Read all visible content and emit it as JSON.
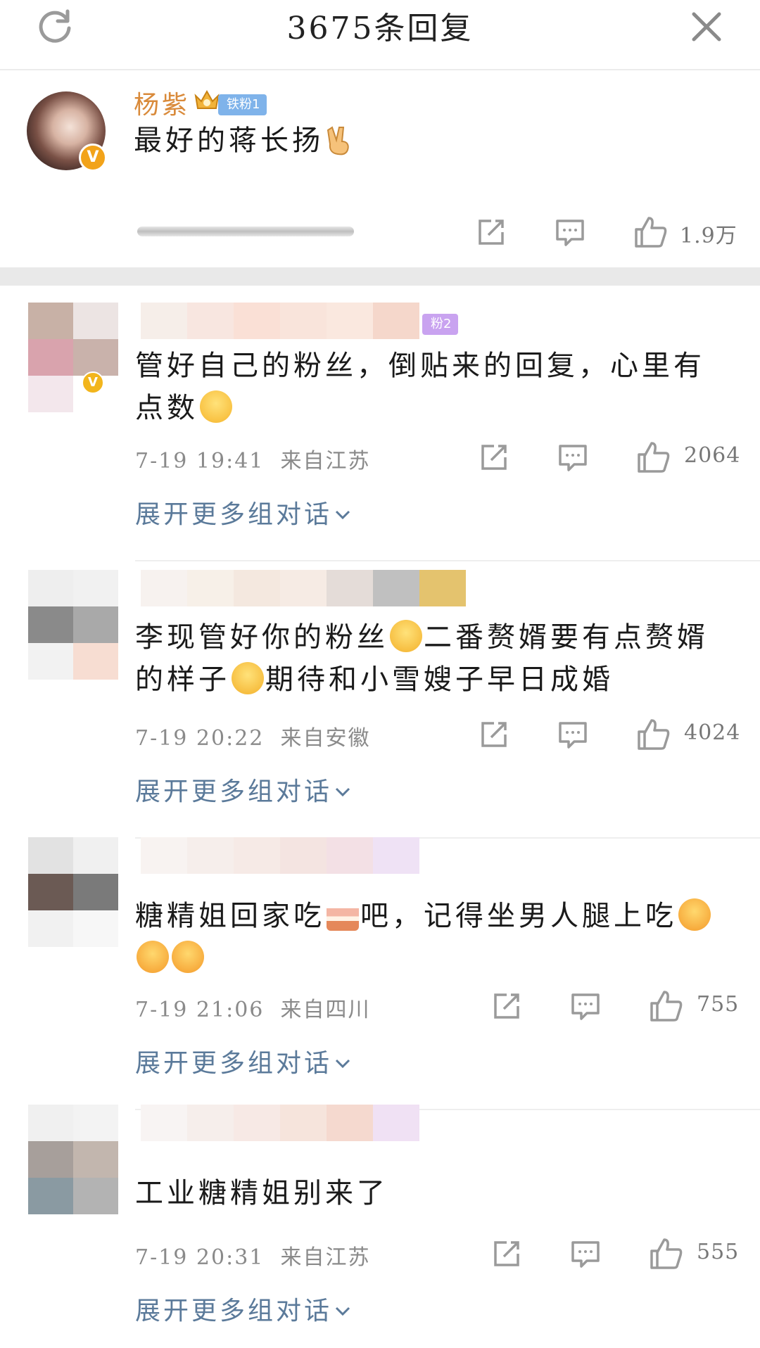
{
  "header": {
    "title": "3675条回复"
  },
  "main_post": {
    "username": "杨紫",
    "fan_badge": "铁粉1",
    "verified_mark": "V",
    "text": "最好的蒋长扬",
    "likes": "1.9万"
  },
  "replies": [
    {
      "badge": "粉2",
      "verified_mark": "V",
      "text": "管好自己的粉丝，倒贴来的回复，心里有点数",
      "time": "7-19 19:41",
      "location": "来自江苏",
      "likes": "2064",
      "expand": "展开更多组对话"
    },
    {
      "text_a": "李现管好你的粉丝",
      "text_b": "二番赘婿要有点赘婿的样子",
      "text_c": "期待和小雪嫂子早日成婚",
      "time": "7-19 20:22",
      "location": "来自安徽",
      "likes": "4024",
      "expand": "展开更多组对话"
    },
    {
      "text_a": "糖精姐回家吃",
      "text_b": "吧，记得坐男人腿上吃",
      "time": "7-19 21:06",
      "location": "来自四川",
      "likes": "755",
      "expand": "展开更多组对话"
    },
    {
      "text": "工业糖精姐别来了",
      "time": "7-19 20:31",
      "location": "来自江苏",
      "likes": "555",
      "expand": "展开更多组对话"
    }
  ],
  "icons": [
    "refresh-icon",
    "close-icon",
    "share-icon",
    "comment-icon",
    "like-icon",
    "crown-icon",
    "victory-hand-icon",
    "chevron-down-icon"
  ],
  "colors": {
    "username": "#d98a3a",
    "fan_badge": "#7fb3ea",
    "link": "#5b7a9a",
    "verified": "#f2a31a"
  }
}
